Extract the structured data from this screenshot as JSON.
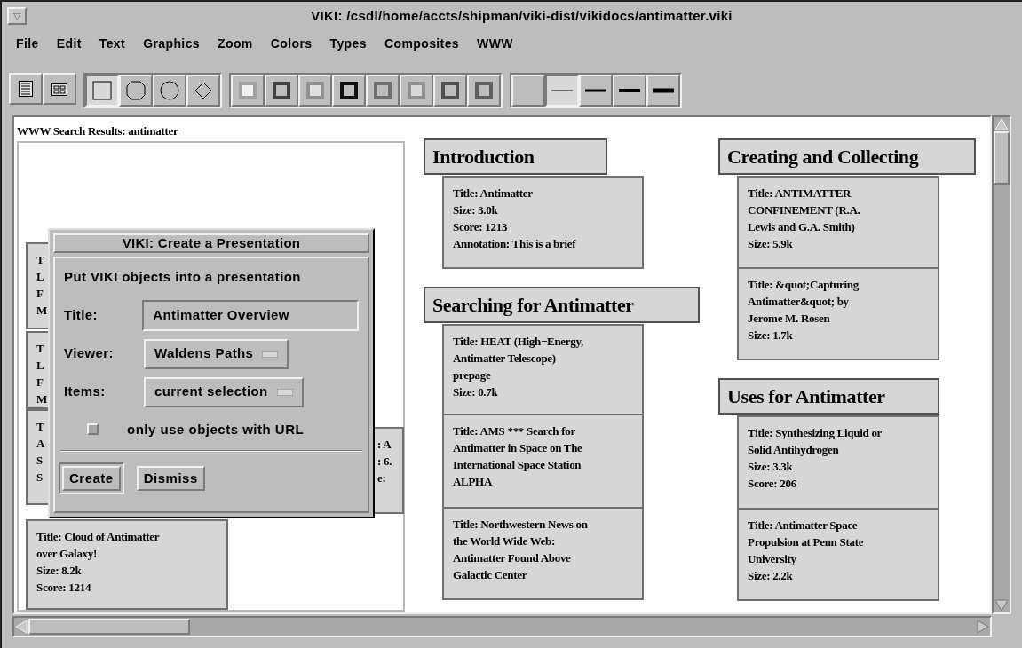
{
  "window": {
    "menu_glyph": "▽",
    "title": "VIKI: /csdl/home/accts/shipman/viki-dist/vikidocs/antimatter.viki"
  },
  "menu": [
    "File",
    "Edit",
    "Text",
    "Graphics",
    "Zoom",
    "Colors",
    "Types",
    "Composites",
    "WWW"
  ],
  "toolbar": {
    "view_buttons": [
      {
        "selected": false
      },
      {
        "selected": false
      }
    ],
    "shape_buttons": [
      {
        "selected": true
      },
      {
        "selected": false
      },
      {
        "selected": false
      },
      {
        "selected": false
      }
    ],
    "border_buttons": [
      {
        "selected": false
      },
      {
        "selected": false
      },
      {
        "selected": false
      },
      {
        "selected": false
      },
      {
        "selected": false
      },
      {
        "selected": false
      },
      {
        "selected": false
      },
      {
        "selected": false
      }
    ],
    "line_buttons": [
      {
        "selected": false
      },
      {
        "selected": true
      },
      {
        "selected": false
      },
      {
        "selected": false
      },
      {
        "selected": false
      }
    ]
  },
  "search_results": {
    "label": "WWW Search Results: antimatter",
    "cards": [
      {
        "lines": [
          "T",
          "L",
          "F",
          "M"
        ]
      },
      {
        "lines": [
          "T",
          "L",
          "F",
          "M"
        ]
      },
      {
        "lines": [
          "T",
          "A",
          "S",
          "S"
        ]
      },
      {
        "lines": [
          ": A",
          ": 6.",
          "e:"
        ]
      },
      {
        "lines": [
          "Title: Cloud of Antimatter",
          "over Galaxy!",
          "Size:  8.2k",
          "Score:  1214"
        ]
      }
    ]
  },
  "collections": [
    {
      "title": "Introduction",
      "cards": [
        {
          "lines": [
            "Title: Antimatter",
            "Size:  3.0k",
            "Score:  1213",
            "Annotation: This is a brief"
          ]
        }
      ]
    },
    {
      "title": "Searching for Antimatter",
      "cards": [
        {
          "lines": [
            "Title: HEAT (High−Energy,",
            "Antimatter Telescope)",
            "prepage",
            "Size:  0.7k"
          ]
        },
        {
          "lines": [
            "Title: AMS *** Search for",
            "Antimatter in Space on The",
            "International Space Station",
            "ALPHA"
          ]
        },
        {
          "lines": [
            "Title: Northwestern News on",
            "the World Wide Web:",
            "Antimatter Found Above",
            "Galactic Center"
          ]
        }
      ]
    },
    {
      "title": "Creating and Collecting",
      "cards": [
        {
          "lines": [
            "Title: ANTIMATTER",
            "CONFINEMENT (R.A.",
            "Lewis and G.A. Smith)",
            "Size:  5.9k"
          ]
        },
        {
          "lines": [
            "Title: &quot;Capturing",
            "Antimatter&quot; by",
            "Jerome M. Rosen",
            "Size:  1.7k"
          ]
        }
      ]
    },
    {
      "title": "Uses for Antimatter",
      "cards": [
        {
          "lines": [
            "Title: Synthesizing Liquid or",
            "Solid Antihydrogen",
            "Size:  3.3k",
            "Score:  206"
          ]
        },
        {
          "lines": [
            "Title: Antimatter Space",
            "Propulsion at Penn State",
            "University",
            "Size:  2.2k"
          ]
        }
      ]
    }
  ],
  "dialog": {
    "title": "VIKI: Create a Presentation",
    "instruction": "Put VIKI objects into a presentation",
    "fields": [
      {
        "label": "Title:",
        "kind": "text",
        "value": "Antimatter Overview"
      },
      {
        "label": "Viewer:",
        "kind": "dropdown",
        "value": "Waldens Paths"
      },
      {
        "label": "Items:",
        "kind": "dropdown",
        "value": "current selection"
      }
    ],
    "checkbox": {
      "label": "only use objects with URL",
      "checked": false
    },
    "buttons": [
      {
        "label": "Create",
        "default": true
      },
      {
        "label": "Dismiss",
        "default": false
      }
    ]
  }
}
